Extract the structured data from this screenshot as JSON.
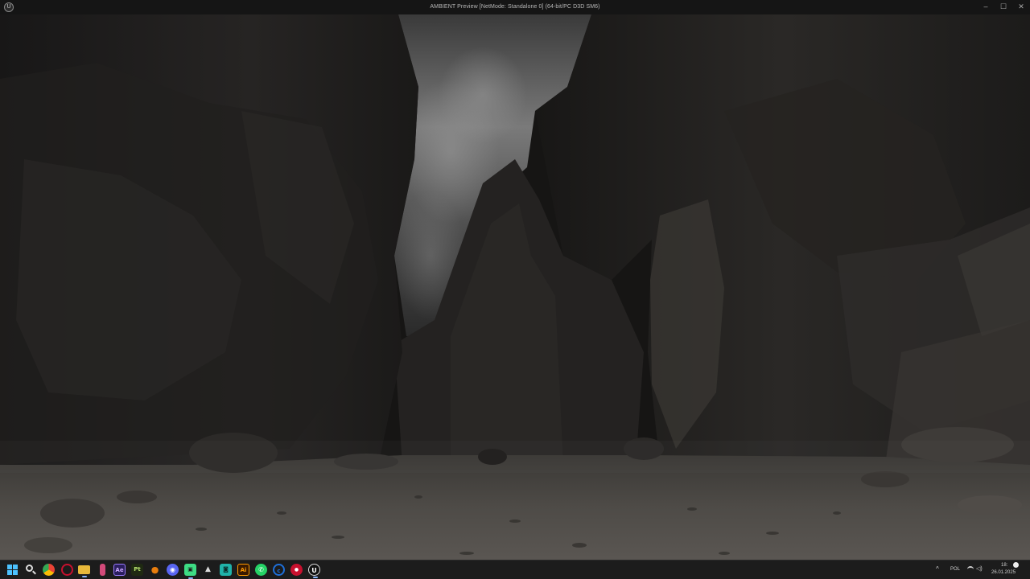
{
  "window": {
    "title": "AMBIENT Preview [NetMode: Standalone 0]  (64-bit/PC D3D SM6)",
    "app_icon": "unreal-engine-icon",
    "controls": {
      "minimize": "–",
      "maximize": "☐",
      "close": "✕"
    }
  },
  "scene": {
    "description_icon": "canyon-scene",
    "sky_color": "#6e6e6e",
    "rock_color": "#1e1c1b",
    "ground_color": "#4a4744"
  },
  "taskbar": {
    "start_icon": "windows-start-icon",
    "search_icon": "search-icon",
    "apps": [
      {
        "name": "chrome",
        "glyph": "",
        "color": "#d8a02a"
      },
      {
        "name": "opera",
        "glyph": "O",
        "color": "#c8102e"
      },
      {
        "name": "file-explorer",
        "glyph": "",
        "color": "#e8b83a"
      },
      {
        "name": "pin",
        "glyph": "▌",
        "color": "#d34a7a"
      },
      {
        "name": "after-effects",
        "glyph": "Ae",
        "color": "#2b1f5e"
      },
      {
        "name": "painter",
        "glyph": "Pt",
        "color": "#2f3f1c"
      },
      {
        "name": "blender",
        "glyph": "●",
        "color": "#e87d0d"
      },
      {
        "name": "discord",
        "glyph": "◉",
        "color": "#5865f2"
      },
      {
        "name": "android",
        "glyph": "▣",
        "color": "#3ddc84"
      },
      {
        "name": "unity",
        "glyph": "▲",
        "color": "#444"
      },
      {
        "name": "photoshop-mini",
        "glyph": "◙",
        "color": "#20b2aa"
      },
      {
        "name": "illustrator",
        "glyph": "Ai",
        "color": "#3a1a00"
      },
      {
        "name": "whatsapp",
        "glyph": "✆",
        "color": "#25d366"
      },
      {
        "name": "cinema",
        "glyph": "©",
        "color": "#1e6fd9"
      },
      {
        "name": "recorder",
        "glyph": "●",
        "color": "#c8102e"
      },
      {
        "name": "unreal-engine",
        "glyph": "U",
        "color": "#222"
      }
    ],
    "tray": {
      "chevron": "^",
      "language": "POL",
      "time": "18:",
      "date": "26.01.2025"
    }
  }
}
